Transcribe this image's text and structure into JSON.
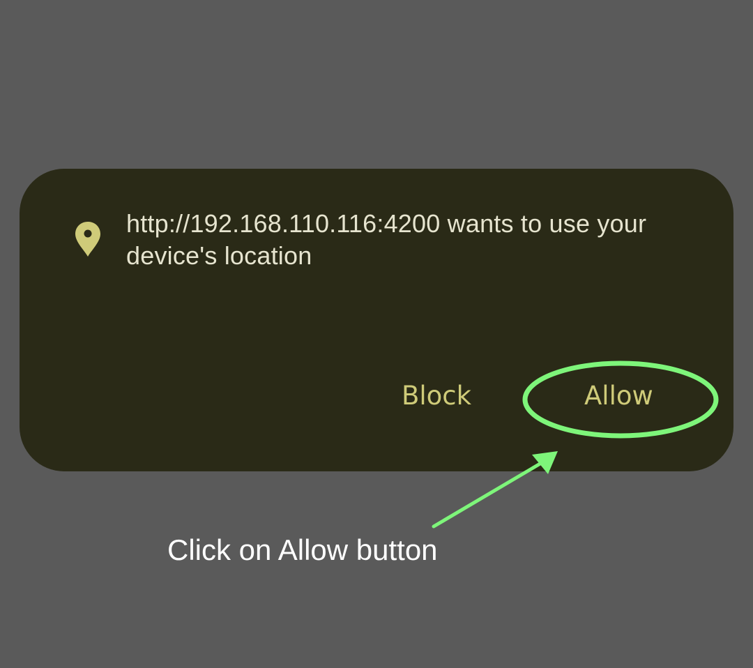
{
  "dialog": {
    "message": "http://192.168.110.116:4200 wants to use your device's location",
    "icon": "location-pin-icon",
    "block_label": "Block",
    "allow_label": "Allow"
  },
  "annotation": {
    "caption": "Click on Allow button",
    "highlight_color": "#7ef57a"
  },
  "colors": {
    "background": "#5a5a5a",
    "dialog_background": "#2a2a17",
    "accent": "#cfcb79",
    "message_text": "#e6e4cf"
  }
}
